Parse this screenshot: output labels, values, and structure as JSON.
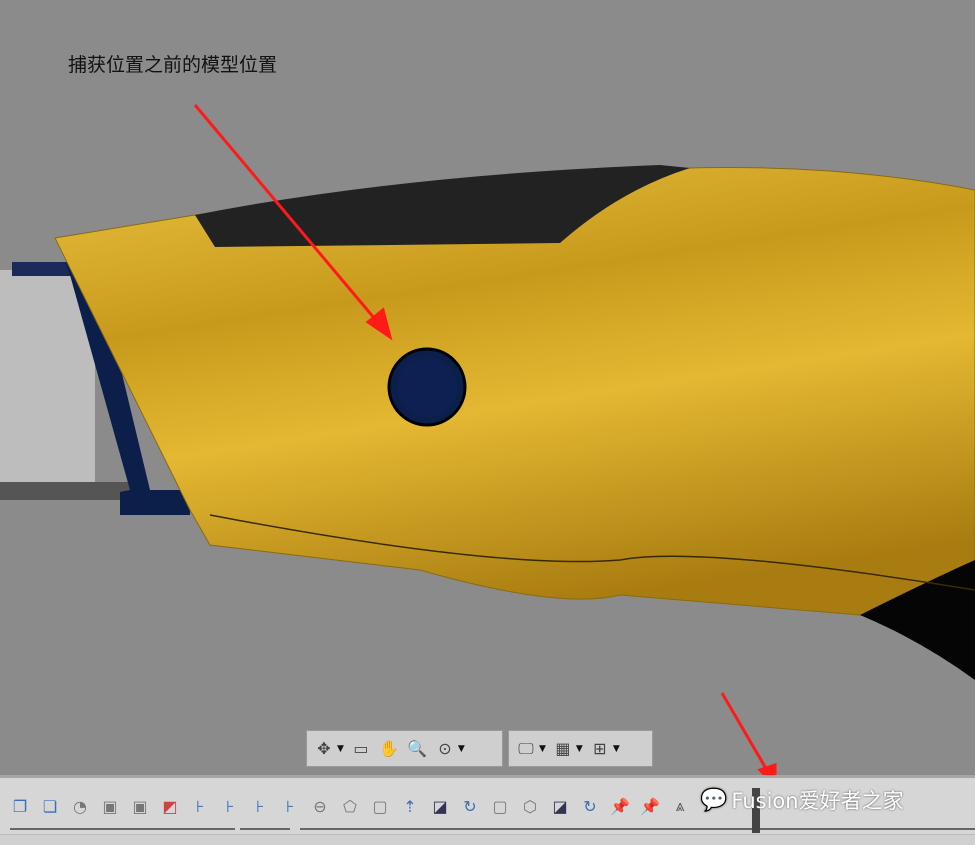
{
  "annotation": {
    "text": "捕获位置之前的模型位置"
  },
  "colors": {
    "body": "#d4a625",
    "grip": "#1a1a1a",
    "button": "#0c1e4a",
    "arrow": "#ff1a1a",
    "background": "#8b8b8b"
  },
  "nav_toolbar": {
    "group1": [
      {
        "icon": "orbit-icon",
        "glyph": "✥",
        "dropdown": true
      },
      {
        "icon": "look-at-icon",
        "glyph": "▭",
        "dropdown": false
      },
      {
        "icon": "pan-hand-icon",
        "glyph": "✋",
        "dropdown": false
      },
      {
        "icon": "zoom-icon",
        "glyph": "🔍",
        "dropdown": false
      },
      {
        "icon": "fit-window-icon",
        "glyph": "⊙",
        "dropdown": true
      }
    ],
    "group2": [
      {
        "icon": "display-settings-icon",
        "glyph": "🖵",
        "dropdown": true
      },
      {
        "icon": "grid-icon",
        "glyph": "▦",
        "dropdown": true
      },
      {
        "icon": "viewports-icon",
        "glyph": "⊞",
        "dropdown": true
      }
    ]
  },
  "timeline_tools": [
    {
      "icon": "box-feature-icon",
      "glyph": "❐",
      "color": "#3b6fb5"
    },
    {
      "icon": "combine-icon",
      "glyph": "❏",
      "color": "#3b6fb5"
    },
    {
      "icon": "fillet-icon",
      "glyph": "◔",
      "color": "#777"
    },
    {
      "icon": "shell-icon",
      "glyph": "▣",
      "color": "#777"
    },
    {
      "icon": "shell-icon",
      "glyph": "▣",
      "color": "#777"
    },
    {
      "icon": "sketch-curve-icon",
      "glyph": "◩",
      "color": "#c44"
    },
    {
      "icon": "joint-icon",
      "glyph": "⊦",
      "color": "#3b6fb5"
    },
    {
      "icon": "joint-icon",
      "glyph": "⊦",
      "color": "#3b6fb5"
    },
    {
      "icon": "joint-icon",
      "glyph": "⊦",
      "color": "#3b6fb5"
    },
    {
      "icon": "joint-icon",
      "glyph": "⊦",
      "color": "#3b6fb5"
    },
    {
      "icon": "revolve-icon",
      "glyph": "⊖",
      "color": "#777"
    },
    {
      "icon": "extrude-icon",
      "glyph": "⬠",
      "color": "#777"
    },
    {
      "icon": "body-icon",
      "glyph": "▢",
      "color": "#777"
    },
    {
      "icon": "extrude-up-icon",
      "glyph": "⇡",
      "color": "#3b6fb5"
    },
    {
      "icon": "sketch-icon",
      "glyph": "◪",
      "color": "#335"
    },
    {
      "icon": "rotate-icon",
      "glyph": "↻",
      "color": "#3b6fb5"
    },
    {
      "icon": "body-icon",
      "glyph": "▢",
      "color": "#777"
    },
    {
      "icon": "chamfer-icon",
      "glyph": "⬡",
      "color": "#777"
    },
    {
      "icon": "sketch-icon",
      "glyph": "◪",
      "color": "#335"
    },
    {
      "icon": "rotate-icon",
      "glyph": "↻",
      "color": "#3b6fb5"
    },
    {
      "icon": "capture-position-icon",
      "glyph": "📌",
      "color": "#d2522a"
    },
    {
      "icon": "capture-position-icon",
      "glyph": "📌",
      "color": "#d2522a"
    },
    {
      "icon": "mirror-icon",
      "glyph": "⩓",
      "color": "#555"
    }
  ],
  "watermark": {
    "text": "Fusion爱好者之家",
    "icon": "wechat-icon"
  }
}
